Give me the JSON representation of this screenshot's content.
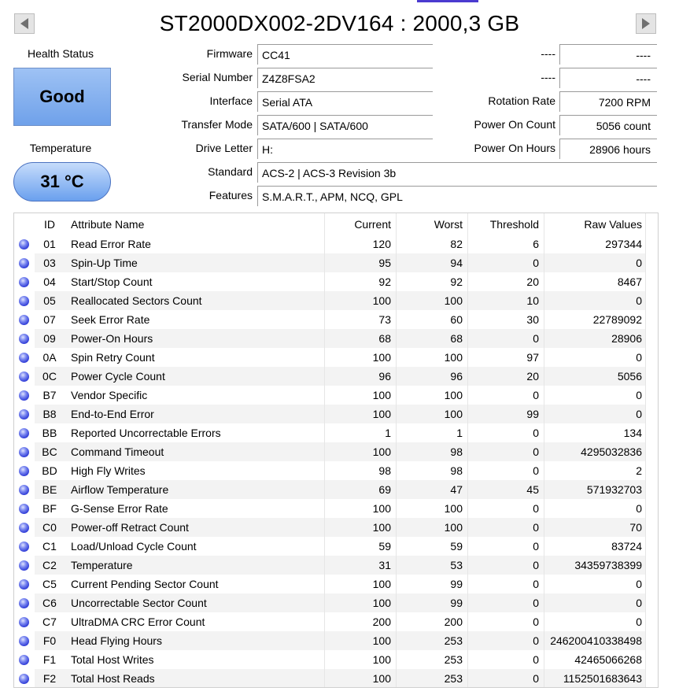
{
  "header": {
    "title": "ST2000DX002-2DV164 : 2000,3 GB"
  },
  "health": {
    "label": "Health Status",
    "value": "Good",
    "color": "#8ab4f2"
  },
  "temperature": {
    "label": "Temperature",
    "value": "31 °C",
    "color": "#8ab4f2"
  },
  "info_left": [
    {
      "label": "Firmware",
      "value": "CC41"
    },
    {
      "label": "Serial Number",
      "value": "Z4Z8FSA2"
    },
    {
      "label": "Interface",
      "value": "Serial ATA"
    },
    {
      "label": "Transfer Mode",
      "value": "SATA/600 | SATA/600"
    },
    {
      "label": "Drive Letter",
      "value": "H:"
    },
    {
      "label": "Standard",
      "value": "ACS-2 | ACS-3 Revision 3b"
    },
    {
      "label": "Features",
      "value": "S.M.A.R.T., APM, NCQ, GPL"
    }
  ],
  "info_right": [
    {
      "label": "----",
      "value": "----"
    },
    {
      "label": "----",
      "value": "----"
    },
    {
      "label": "Rotation Rate",
      "value": "7200 RPM"
    },
    {
      "label": "Power On Count",
      "value": "5056 count"
    },
    {
      "label": "Power On Hours",
      "value": "28906 hours"
    }
  ],
  "table": {
    "columns": [
      "ID",
      "Attribute Name",
      "Current",
      "Worst",
      "Threshold",
      "Raw Values"
    ],
    "status_dot_color": "#3a46e0",
    "rows": [
      {
        "id": "01",
        "name": "Read Error Rate",
        "current": "120",
        "worst": "82",
        "threshold": "6",
        "raw": "297344"
      },
      {
        "id": "03",
        "name": "Spin-Up Time",
        "current": "95",
        "worst": "94",
        "threshold": "0",
        "raw": "0"
      },
      {
        "id": "04",
        "name": "Start/Stop Count",
        "current": "92",
        "worst": "92",
        "threshold": "20",
        "raw": "8467"
      },
      {
        "id": "05",
        "name": "Reallocated Sectors Count",
        "current": "100",
        "worst": "100",
        "threshold": "10",
        "raw": "0"
      },
      {
        "id": "07",
        "name": "Seek Error Rate",
        "current": "73",
        "worst": "60",
        "threshold": "30",
        "raw": "22789092"
      },
      {
        "id": "09",
        "name": "Power-On Hours",
        "current": "68",
        "worst": "68",
        "threshold": "0",
        "raw": "28906"
      },
      {
        "id": "0A",
        "name": "Spin Retry Count",
        "current": "100",
        "worst": "100",
        "threshold": "97",
        "raw": "0"
      },
      {
        "id": "0C",
        "name": "Power Cycle Count",
        "current": "96",
        "worst": "96",
        "threshold": "20",
        "raw": "5056"
      },
      {
        "id": "B7",
        "name": "Vendor Specific",
        "current": "100",
        "worst": "100",
        "threshold": "0",
        "raw": "0"
      },
      {
        "id": "B8",
        "name": "End-to-End Error",
        "current": "100",
        "worst": "100",
        "threshold": "99",
        "raw": "0"
      },
      {
        "id": "BB",
        "name": "Reported Uncorrectable Errors",
        "current": "1",
        "worst": "1",
        "threshold": "0",
        "raw": "134"
      },
      {
        "id": "BC",
        "name": "Command Timeout",
        "current": "100",
        "worst": "98",
        "threshold": "0",
        "raw": "4295032836"
      },
      {
        "id": "BD",
        "name": "High Fly Writes",
        "current": "98",
        "worst": "98",
        "threshold": "0",
        "raw": "2"
      },
      {
        "id": "BE",
        "name": "Airflow Temperature",
        "current": "69",
        "worst": "47",
        "threshold": "45",
        "raw": "571932703"
      },
      {
        "id": "BF",
        "name": "G-Sense Error Rate",
        "current": "100",
        "worst": "100",
        "threshold": "0",
        "raw": "0"
      },
      {
        "id": "C0",
        "name": "Power-off Retract Count",
        "current": "100",
        "worst": "100",
        "threshold": "0",
        "raw": "70"
      },
      {
        "id": "C1",
        "name": "Load/Unload Cycle Count",
        "current": "59",
        "worst": "59",
        "threshold": "0",
        "raw": "83724"
      },
      {
        "id": "C2",
        "name": "Temperature",
        "current": "31",
        "worst": "53",
        "threshold": "0",
        "raw": "34359738399"
      },
      {
        "id": "C5",
        "name": "Current Pending Sector Count",
        "current": "100",
        "worst": "99",
        "threshold": "0",
        "raw": "0"
      },
      {
        "id": "C6",
        "name": "Uncorrectable Sector Count",
        "current": "100",
        "worst": "99",
        "threshold": "0",
        "raw": "0"
      },
      {
        "id": "C7",
        "name": "UltraDMA CRC Error Count",
        "current": "200",
        "worst": "200",
        "threshold": "0",
        "raw": "0"
      },
      {
        "id": "F0",
        "name": "Head Flying Hours",
        "current": "100",
        "worst": "253",
        "threshold": "0",
        "raw": "246200410338498"
      },
      {
        "id": "F1",
        "name": "Total Host Writes",
        "current": "100",
        "worst": "253",
        "threshold": "0",
        "raw": "42465066268"
      },
      {
        "id": "F2",
        "name": "Total Host Reads",
        "current": "100",
        "worst": "253",
        "threshold": "0",
        "raw": "1152501683643"
      }
    ]
  }
}
